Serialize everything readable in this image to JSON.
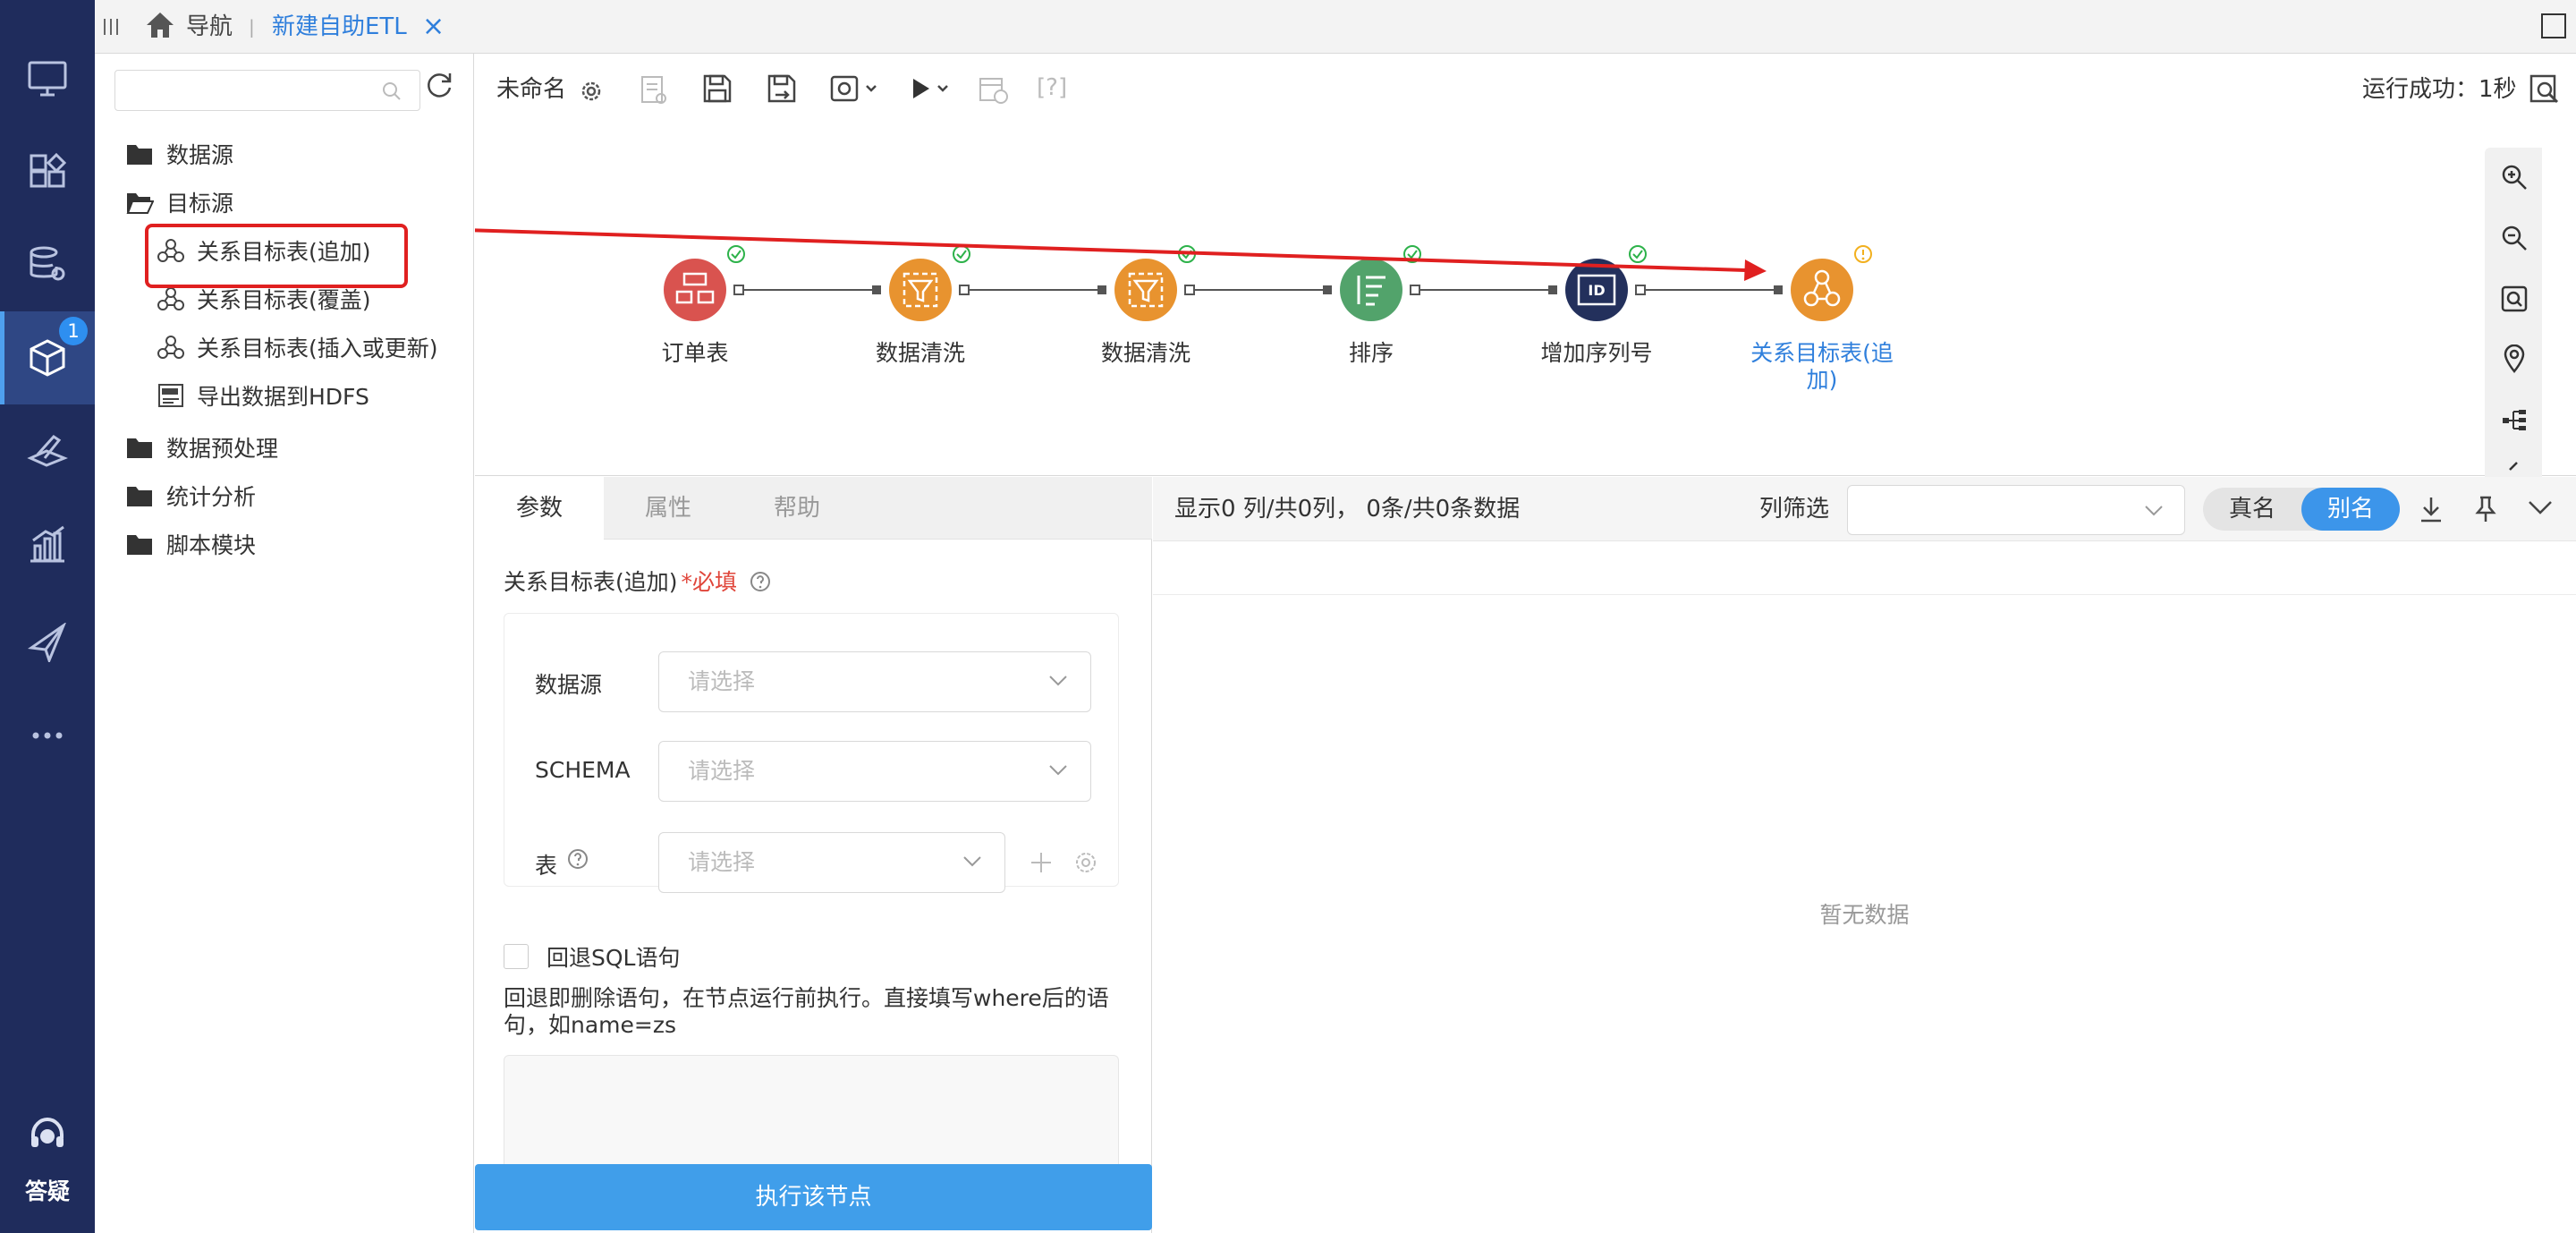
{
  "nav": {
    "badge": "1",
    "help_label": "答疑"
  },
  "topbar": {
    "home_label": "导航",
    "separator": "|",
    "tab_label": "新建自助ETL",
    "close_glyph": "×"
  },
  "tree": {
    "search_placeholder": "",
    "items": [
      {
        "label": "数据源"
      },
      {
        "label": "目标源"
      },
      {
        "label": "关系目标表(追加)"
      },
      {
        "label": "关系目标表(覆盖)"
      },
      {
        "label": "关系目标表(插入或更新)"
      },
      {
        "label": "导出数据到HDFS"
      },
      {
        "label": "数据预处理"
      },
      {
        "label": "统计分析"
      },
      {
        "label": "脚本模块"
      }
    ]
  },
  "toolbar": {
    "name": "未命名",
    "help_glyph": "[?]",
    "status": "运行成功：1秒"
  },
  "flow": {
    "nodes": [
      {
        "label": "订单表",
        "color": "#d9534f",
        "status": "ok"
      },
      {
        "label": "数据清洗",
        "color": "#e8932f",
        "status": "ok"
      },
      {
        "label": "数据清洗",
        "color": "#e8932f",
        "status": "ok"
      },
      {
        "label": "排序",
        "color": "#52a36b",
        "status": "ok"
      },
      {
        "label": "增加序列号",
        "color": "#23305c",
        "status": "ok"
      },
      {
        "label": "关系目标表(追加)",
        "color": "#e8932f",
        "status": "warning"
      }
    ]
  },
  "params": {
    "tabs": [
      {
        "label": "参数"
      },
      {
        "label": "属性"
      },
      {
        "label": "帮助"
      }
    ],
    "title": "关系目标表(追加)",
    "required_mark": "*必填",
    "fields": [
      {
        "label": "数据源",
        "placeholder": "请选择"
      },
      {
        "label": "SCHEMA",
        "placeholder": "请选择"
      },
      {
        "label": "表",
        "placeholder": "请选择"
      }
    ],
    "rollback_label": "回退SQL语句",
    "rollback_hint": "回退即删除语句，在节点运行前执行。直接填写where后的语句，如name=zs",
    "run_button": "执行该节点"
  },
  "preview": {
    "summary": "显示0 列/共0列，  0条/共0条数据",
    "filter_label": "列筛选",
    "toggle_real": "真名",
    "toggle_alias": "别名",
    "empty_text": "暂无数据"
  },
  "colors": {
    "nav_bg": "#1f2c5c",
    "accent": "#409eea",
    "highlight": "#e02020"
  }
}
